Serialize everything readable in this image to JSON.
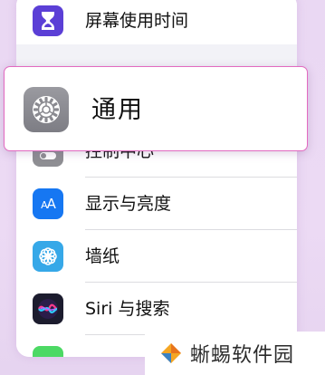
{
  "settings": {
    "screen_time": {
      "label": "屏幕使用时间",
      "icon": "hourglass-icon",
      "color": "#5b3fd6"
    },
    "general": {
      "label": "通用",
      "icon": "gear-icon",
      "color": "#8e8e93"
    },
    "items": [
      {
        "label": "控制中心",
        "icon": "toggles-icon",
        "color": "#8e8e93"
      },
      {
        "label": "显示与亮度",
        "icon": "text-size-icon",
        "color": "#1677f2"
      },
      {
        "label": "墙纸",
        "icon": "flower-icon",
        "color": "#36a8e8"
      },
      {
        "label": "Siri 与搜索",
        "icon": "siri-icon",
        "color": "#1c1c2e"
      }
    ]
  },
  "watermark": {
    "text": "蜥蜴软件园"
  }
}
